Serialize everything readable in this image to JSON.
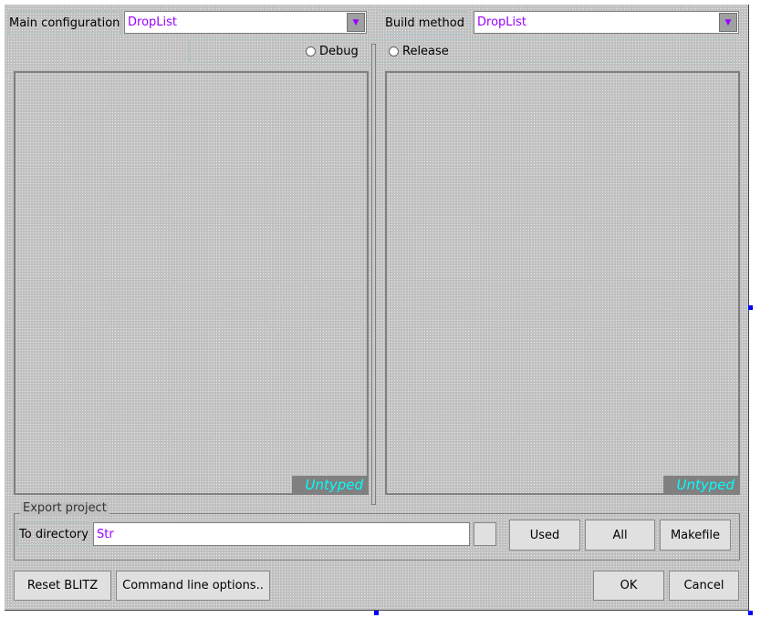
{
  "top": {
    "main_config_label": "Main configuration",
    "main_config_value": "DropList",
    "build_method_label": "Build method",
    "build_method_value": "DropList"
  },
  "radios": {
    "debug": "Debug",
    "release": "Release"
  },
  "panels": {
    "left_type": "Untyped",
    "right_type": "Untyped"
  },
  "export": {
    "group_label": "Export project",
    "dir_label": "To directory",
    "dir_value": "Str",
    "used": "Used",
    "all": "All",
    "makefile": "Makefile"
  },
  "bottom": {
    "reset": "Reset BLITZ",
    "cmdline": "Command line options..",
    "ok": "OK",
    "cancel": "Cancel"
  }
}
